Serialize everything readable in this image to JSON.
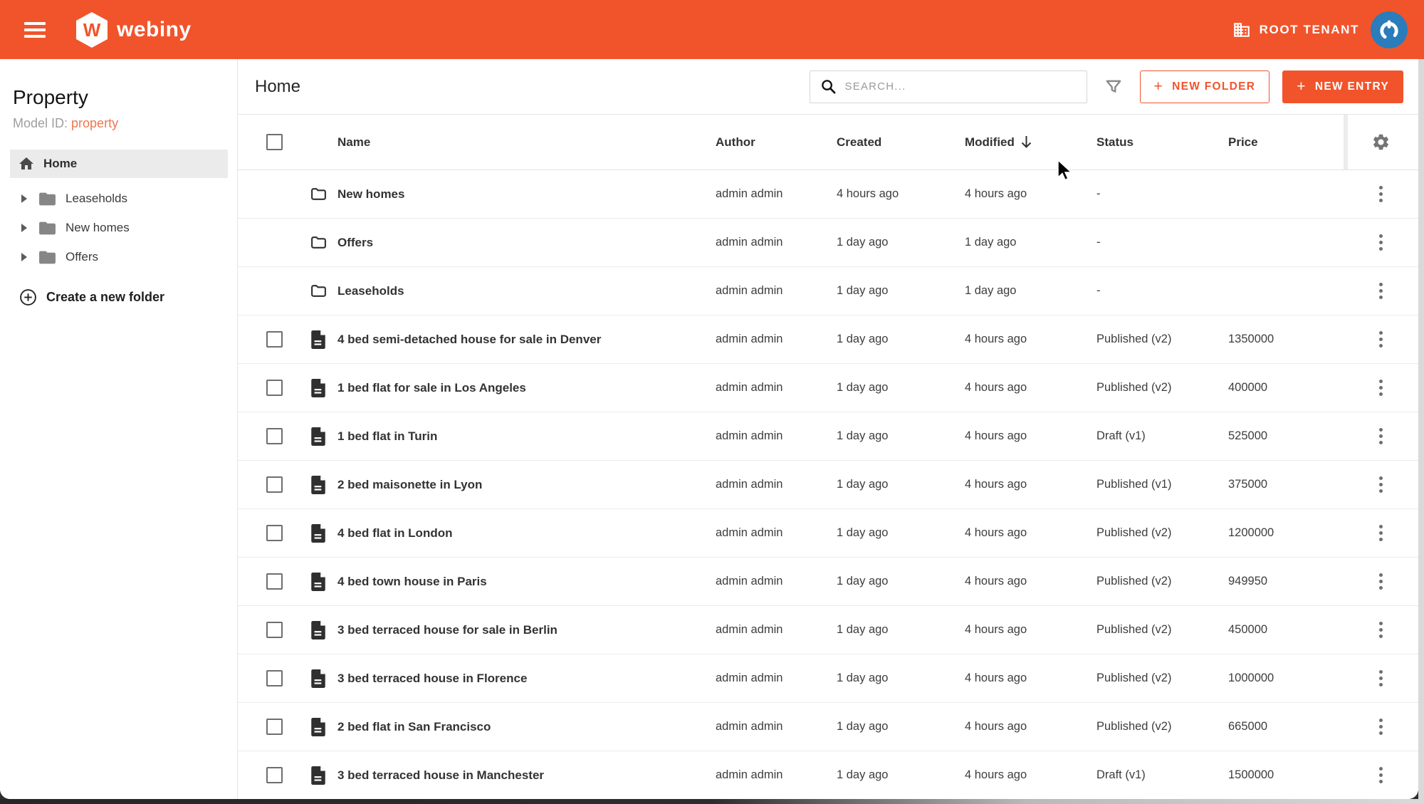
{
  "colors": {
    "primary": "#f1542b",
    "primary_light": "#f0744f",
    "avatar_blue": "#2b7cba",
    "selected_bg": "#ebebeb"
  },
  "icons": {
    "plus": "+",
    "menu": "hamburger",
    "search": "magnifier",
    "filter": "funnel",
    "settings": "gear",
    "more": "kebab-vertical",
    "sort": "arrow-down"
  },
  "topbar": {
    "brand": "webiny",
    "tenant": "ROOT TENANT"
  },
  "sidebar": {
    "title": "Property",
    "model_id_label": "Model ID: ",
    "model_id_value": "property",
    "home_label": "Home",
    "folders": [
      {
        "label": "Leaseholds"
      },
      {
        "label": "New homes"
      },
      {
        "label": "Offers"
      }
    ],
    "create_folder_label": "Create a new folder"
  },
  "toolbar": {
    "title": "Home",
    "search_placeholder": "SEARCH...",
    "new_folder_label": "NEW FOLDER",
    "new_entry_label": "NEW ENTRY"
  },
  "table": {
    "columns": {
      "name": "Name",
      "author": "Author",
      "created": "Created",
      "modified": "Modified",
      "status": "Status",
      "price": "Price"
    },
    "sort": {
      "column": "Modified",
      "direction": "desc"
    },
    "rows": [
      {
        "type": "folder",
        "name": "New homes",
        "author": "admin admin",
        "created": "4 hours ago",
        "modified": "4 hours ago",
        "status": "-",
        "price": ""
      },
      {
        "type": "folder",
        "name": "Offers",
        "author": "admin admin",
        "created": "1 day ago",
        "modified": "1 day ago",
        "status": "-",
        "price": ""
      },
      {
        "type": "folder",
        "name": "Leaseholds",
        "author": "admin admin",
        "created": "1 day ago",
        "modified": "1 day ago",
        "status": "-",
        "price": ""
      },
      {
        "type": "entry",
        "name": "4 bed semi-detached house for sale in Denver",
        "author": "admin admin",
        "created": "1 day ago",
        "modified": "4 hours ago",
        "status": "Published (v2)",
        "price": "1350000"
      },
      {
        "type": "entry",
        "name": "1 bed flat for sale in Los Angeles",
        "author": "admin admin",
        "created": "1 day ago",
        "modified": "4 hours ago",
        "status": "Published (v2)",
        "price": "400000"
      },
      {
        "type": "entry",
        "name": "1 bed flat in Turin",
        "author": "admin admin",
        "created": "1 day ago",
        "modified": "4 hours ago",
        "status": "Draft (v1)",
        "price": "525000"
      },
      {
        "type": "entry",
        "name": "2 bed maisonette in Lyon",
        "author": "admin admin",
        "created": "1 day ago",
        "modified": "4 hours ago",
        "status": "Published (v1)",
        "price": "375000"
      },
      {
        "type": "entry",
        "name": "4 bed flat in London",
        "author": "admin admin",
        "created": "1 day ago",
        "modified": "4 hours ago",
        "status": "Published (v2)",
        "price": "1200000"
      },
      {
        "type": "entry",
        "name": "4 bed town house in Paris",
        "author": "admin admin",
        "created": "1 day ago",
        "modified": "4 hours ago",
        "status": "Published (v2)",
        "price": "949950"
      },
      {
        "type": "entry",
        "name": "3 bed terraced house for sale in Berlin",
        "author": "admin admin",
        "created": "1 day ago",
        "modified": "4 hours ago",
        "status": "Published (v2)",
        "price": "450000"
      },
      {
        "type": "entry",
        "name": "3 bed terraced house in Florence",
        "author": "admin admin",
        "created": "1 day ago",
        "modified": "4 hours ago",
        "status": "Published (v2)",
        "price": "1000000"
      },
      {
        "type": "entry",
        "name": "2 bed flat in San Francisco",
        "author": "admin admin",
        "created": "1 day ago",
        "modified": "4 hours ago",
        "status": "Published (v2)",
        "price": "665000"
      },
      {
        "type": "entry",
        "name": "3 bed terraced house in Manchester",
        "author": "admin admin",
        "created": "1 day ago",
        "modified": "4 hours ago",
        "status": "Draft (v1)",
        "price": "1500000"
      }
    ]
  }
}
